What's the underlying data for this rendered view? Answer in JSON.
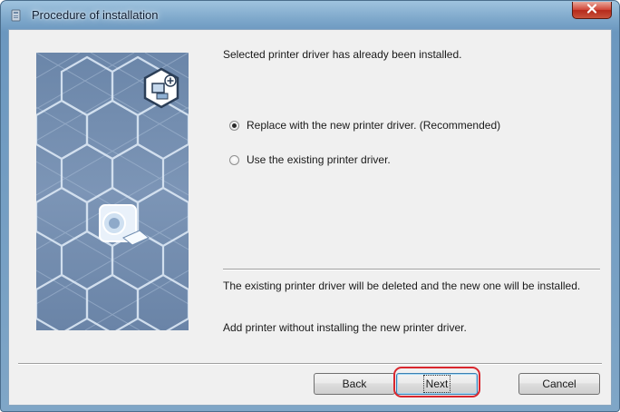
{
  "window": {
    "title": "Procedure of installation",
    "icons": {
      "app": "installer-app-icon",
      "close": "close-icon"
    }
  },
  "banner": {
    "icons": [
      "computer-add-icon",
      "printer-icon"
    ]
  },
  "message": "Selected printer driver has already been installed.",
  "options": [
    {
      "label": "Replace with the new printer driver. (Recommended)",
      "selected": true
    },
    {
      "label": "Use the existing printer driver.",
      "selected": false
    }
  ],
  "description": {
    "replace": "The existing printer driver will be deleted and the new one will be installed.",
    "existing": "Add printer without installing the new printer driver."
  },
  "buttons": {
    "back": "Back",
    "next": "Next",
    "cancel": "Cancel"
  },
  "colors": {
    "highlight": "#d9272e",
    "close_button": "#c8523b",
    "banner": "#7c95b6"
  }
}
